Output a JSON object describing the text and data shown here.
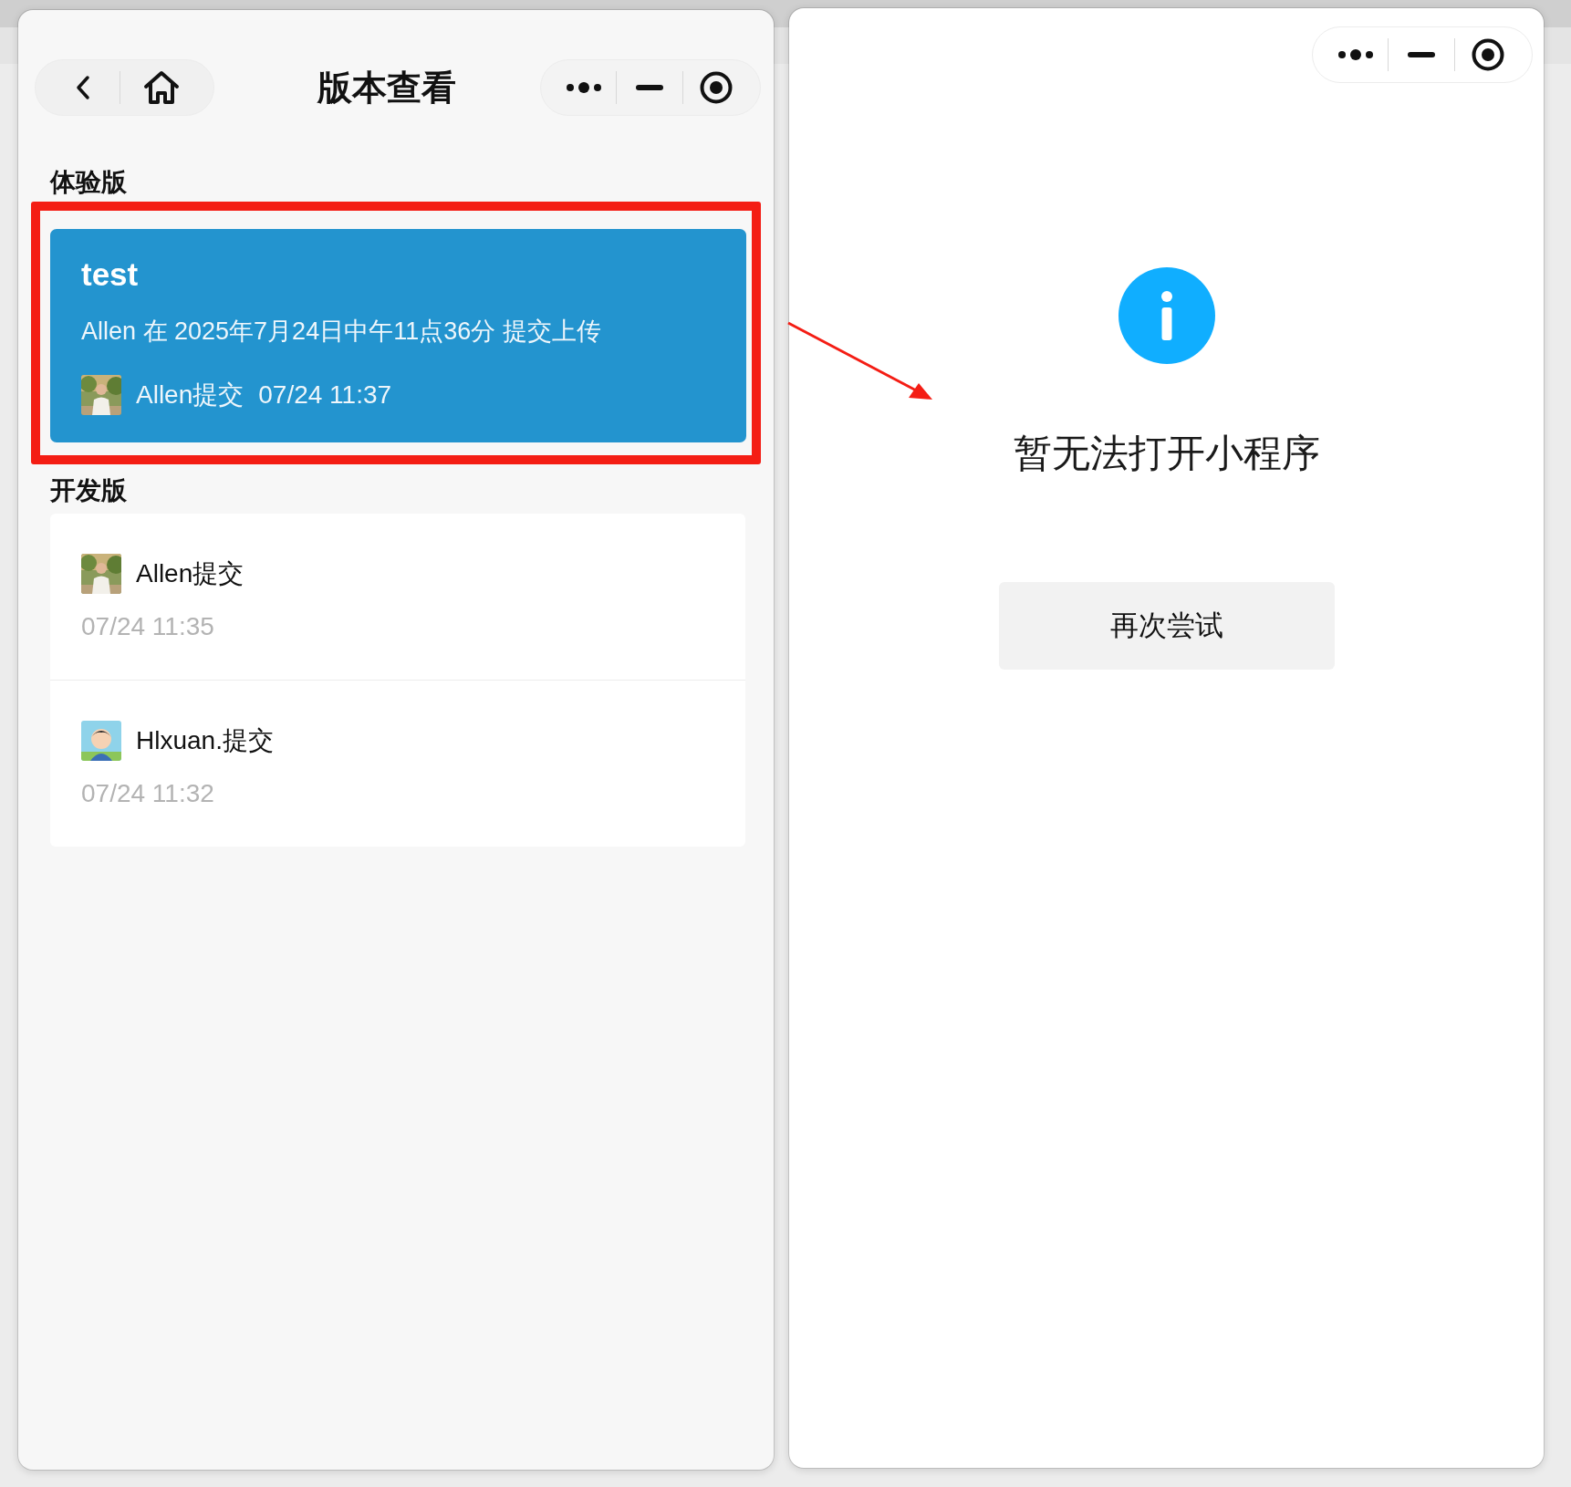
{
  "left_window": {
    "title": "版本查看",
    "trial": {
      "heading": "体验版",
      "highlighted": true,
      "card": {
        "title": "test",
        "description": "Allen 在 2025年7月24日中午11点36分 提交上传",
        "submitter": "Allen提交",
        "time": "07/24 11:37"
      }
    },
    "development": {
      "heading": "开发版",
      "items": [
        {
          "submitter": "Allen提交",
          "time": "07/24 11:35"
        },
        {
          "submitter": "Hlxuan.提交",
          "time": "07/24 11:32",
          "kind": "cartoon"
        }
      ]
    }
  },
  "right_window": {
    "message": "暂无法打开小程序",
    "button": "再次尝试"
  },
  "annotation_arrow": true
}
